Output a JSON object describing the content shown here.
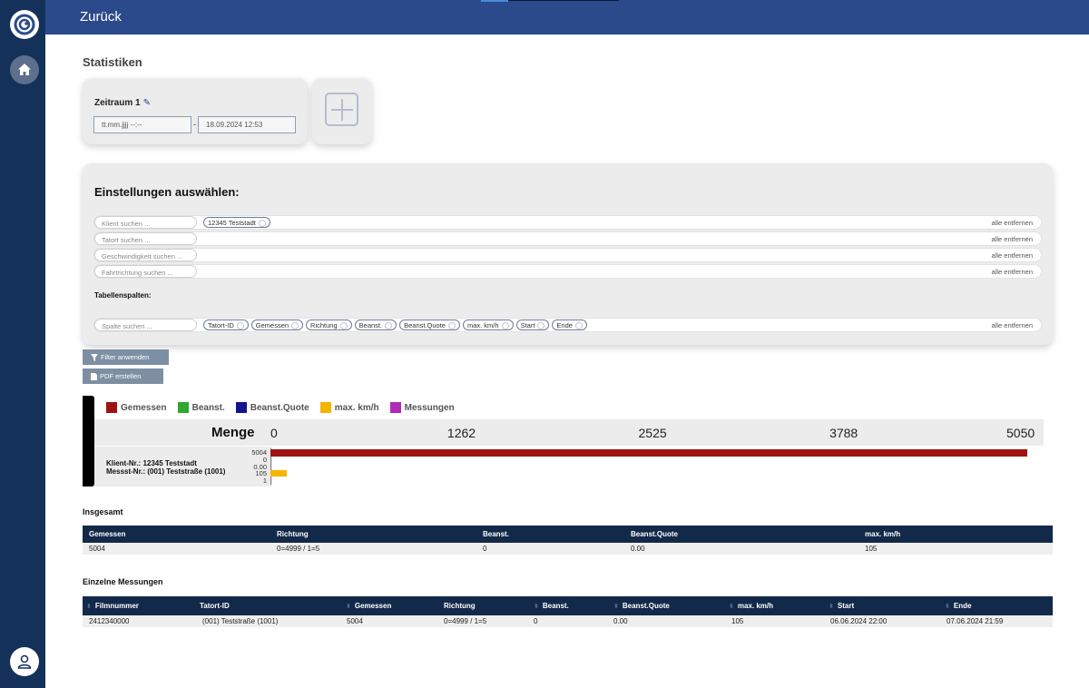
{
  "header": {
    "back_label": "Zurück"
  },
  "page": {
    "title": "Statistiken"
  },
  "period": {
    "title": "Zeitraum 1",
    "start_placeholder": "tt.mm.jjjj --:--",
    "end_value": "18.09.2024 12:53",
    "separator": "-"
  },
  "settings": {
    "title": "Einstellungen auswählen:",
    "columns_label": "Tabellenspalten:",
    "remove_all_label": "alle entfernen",
    "rows": [
      {
        "placeholder": "Klient suchen ...",
        "chips": [
          "12345 Teststadt"
        ]
      },
      {
        "placeholder": "Tatort suchen ...",
        "chips": []
      },
      {
        "placeholder": "Geschwindigkeit suchen ...",
        "chips": []
      },
      {
        "placeholder": "Fahrtrichtung suchen ...",
        "chips": []
      }
    ],
    "columns_row": {
      "placeholder": "Spalte suchen ...",
      "chips": [
        "Tatort-ID",
        "Gemessen",
        "Richtung",
        "Beanst.",
        "Beanst.Quote",
        "max. km/h",
        "Start",
        "Ende"
      ]
    }
  },
  "buttons": {
    "filter_label": "Filter anwenden",
    "pdf_label": "PDF erstellen"
  },
  "chart_data": {
    "type": "bar",
    "orientation": "horizontal",
    "axis_label": "Menge",
    "xlim": [
      0,
      5050
    ],
    "ticks": [
      "0",
      "1262",
      "2525",
      "3788",
      "5050"
    ],
    "legend": [
      {
        "name": "Gemessen",
        "color": "#a01212"
      },
      {
        "name": "Beanst.",
        "color": "#2fa82f"
      },
      {
        "name": "Beanst.Quote",
        "color": "#14148c"
      },
      {
        "name": "max. km/h",
        "color": "#f5b400"
      },
      {
        "name": "Messungen",
        "color": "#b02ab7"
      }
    ],
    "categories": [
      "Klient-Nr.: 12345 Teststadt",
      "Messst-Nr.: (001) Teststraße (1001)"
    ],
    "series": [
      {
        "name": "Gemessen",
        "value": 5004,
        "label": "5004"
      },
      {
        "name": "Beanst.",
        "value": 0,
        "label": "0"
      },
      {
        "name": "Beanst.Quote",
        "value": 0,
        "label": "0.00"
      },
      {
        "name": "max. km/h",
        "value": 105,
        "label": "105"
      },
      {
        "name": "Messungen",
        "value": 1,
        "label": "1"
      }
    ]
  },
  "summary": {
    "title": "Insgesamt",
    "headers": [
      "Gemessen",
      "Richtung",
      "Beanst.",
      "Beanst.Quote",
      "max. km/h"
    ],
    "row": [
      "5004",
      "0=4999 / 1=5",
      "0",
      "0.00",
      "105"
    ]
  },
  "details": {
    "title": "Einzelne Messungen",
    "sort_icon": "⬍",
    "headers": [
      "Filmnummer",
      "Tatort-ID",
      "Gemessen",
      "Richtung",
      "Beanst.",
      "Beanst.Quote",
      "max. km/h",
      "Start",
      "Ende"
    ],
    "sortable": [
      true,
      false,
      true,
      false,
      true,
      true,
      true,
      true,
      true
    ],
    "row": [
      "2412340000",
      "(001) Teststraße (1001)",
      "5004",
      "0=4999 / 1=5",
      "0",
      "0.00",
      "105",
      "06.06.2024 22:00",
      "07.06.2024 21:59"
    ]
  },
  "colors": {
    "sidebar": "#14315a",
    "header": "#2b4a8b",
    "table_head": "#13294a",
    "button": "#7d8fa3"
  }
}
